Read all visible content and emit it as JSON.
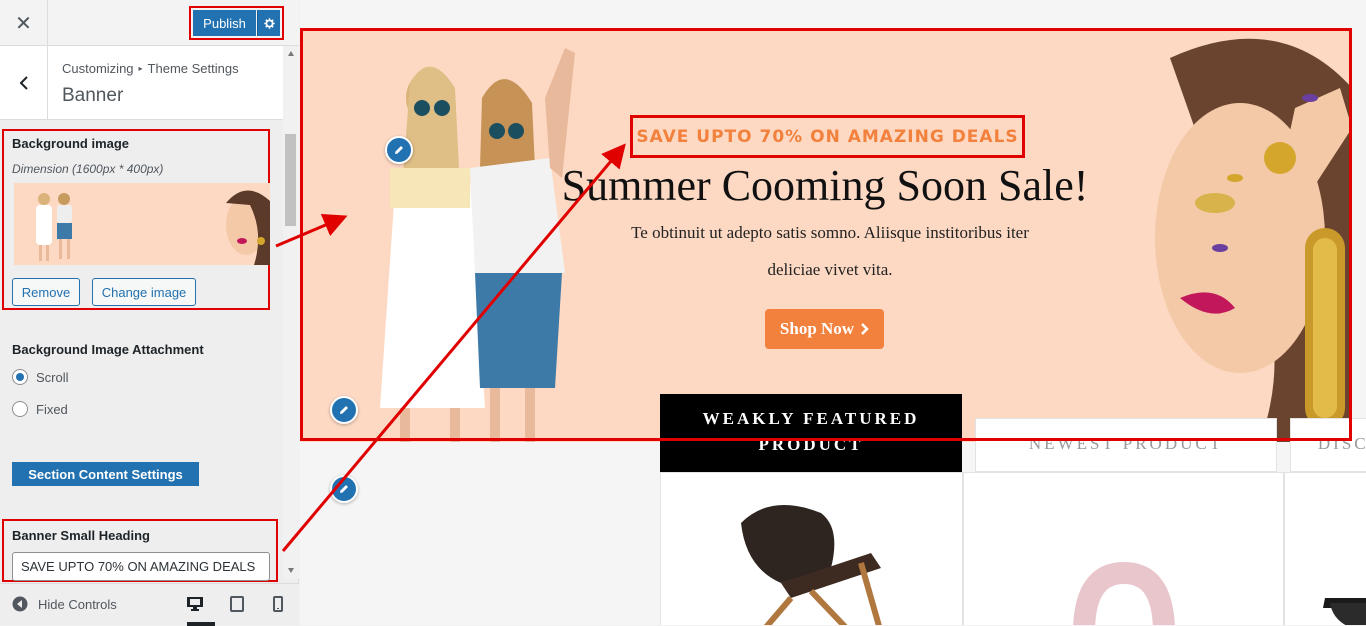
{
  "topbar": {
    "close_icon": "close-icon",
    "publish_label": "Publish",
    "publish_settings_icon": "gear-icon"
  },
  "section_header": {
    "breadcrumb_parent": "Customizing",
    "breadcrumb_child": "Theme Settings",
    "title": "Banner"
  },
  "background_image": {
    "label": "Background image",
    "dimension_note": "Dimension (1600px * 400px)",
    "remove_label": "Remove",
    "change_label": "Change image"
  },
  "attachment": {
    "label": "Background Image Attachment",
    "options": [
      {
        "label": "Scroll",
        "selected": true
      },
      {
        "label": "Fixed",
        "selected": false
      }
    ]
  },
  "section_content_button": "Section Content Settings",
  "banner_small_heading": {
    "label": "Banner Small Heading",
    "value": "SAVE UPTO 70% ON AMAZING DEALS"
  },
  "footer": {
    "hide_controls_label": "Hide Controls",
    "devices": [
      "desktop-icon",
      "tablet-icon",
      "mobile-icon"
    ]
  },
  "preview": {
    "banner": {
      "small_heading": "SAVE UPTO 70% ON AMAZING DEALS",
      "title": "Summer Cooming Soon Sale!",
      "description_line1": "Te obtinuit ut adepto satis somno. Aliisque institoribus iter",
      "description_line2": "deliciae vivet vita.",
      "button_label": "Shop Now"
    },
    "tabs": [
      "WEAKLY FEATURED PRODUCT",
      "NEWEST PRODUCT",
      "DISCOUNTED PRODUCT"
    ],
    "product_icons": [
      "chair-image",
      "headphones-image",
      "sunglasses-image"
    ]
  },
  "colors": {
    "accent": "#2271b1",
    "highlight": "#e00000",
    "banner_orange": "#f2813d",
    "banner_bg": "#fdd9c3"
  }
}
